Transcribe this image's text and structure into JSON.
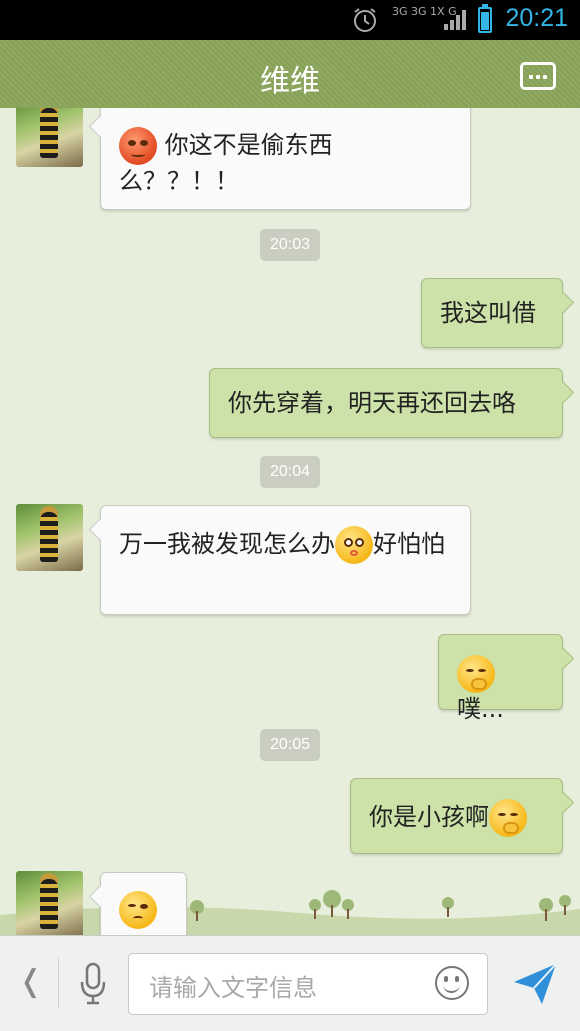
{
  "status_bar": {
    "time": "20:21",
    "network": "3G 3G 1X G",
    "battery_level": 0.8,
    "icons": [
      "alarm-icon",
      "signal-icon",
      "battery-icon"
    ]
  },
  "header": {
    "title": "维维",
    "menu_icon": "more-dots-icon"
  },
  "chat": {
    "messages": [
      {
        "side": "left",
        "emoji_before": "angry",
        "text": "你这不是偷东西么？？！！"
      },
      {
        "type": "timestamp",
        "text": "20:03"
      },
      {
        "side": "right",
        "text": "我这叫借"
      },
      {
        "side": "right",
        "text": "你先穿着，明天再还回去咯"
      },
      {
        "type": "timestamp",
        "text": "20:04"
      },
      {
        "side": "left",
        "text_before": "万一我被发现怎么办",
        "emoji": "shy",
        "text_after": "好怕怕"
      },
      {
        "side": "right",
        "emoji_before": "giggle",
        "text": "噗..."
      },
      {
        "type": "timestamp",
        "text": "20:05"
      },
      {
        "side": "right",
        "text": "你是小孩啊",
        "emoji_after": "giggle"
      },
      {
        "side": "left",
        "emoji": "smirk"
      }
    ]
  },
  "input_bar": {
    "placeholder": "请输入文字信息",
    "icons": [
      "back-chevron-icon",
      "microphone-icon",
      "emoji-icon",
      "send-icon"
    ]
  },
  "colors": {
    "header": "#8ba55a",
    "background": "#e7efdc",
    "bubble_right": "#cde2a8",
    "bubble_left": "#fafafa",
    "status_accent": "#33b5e5"
  }
}
